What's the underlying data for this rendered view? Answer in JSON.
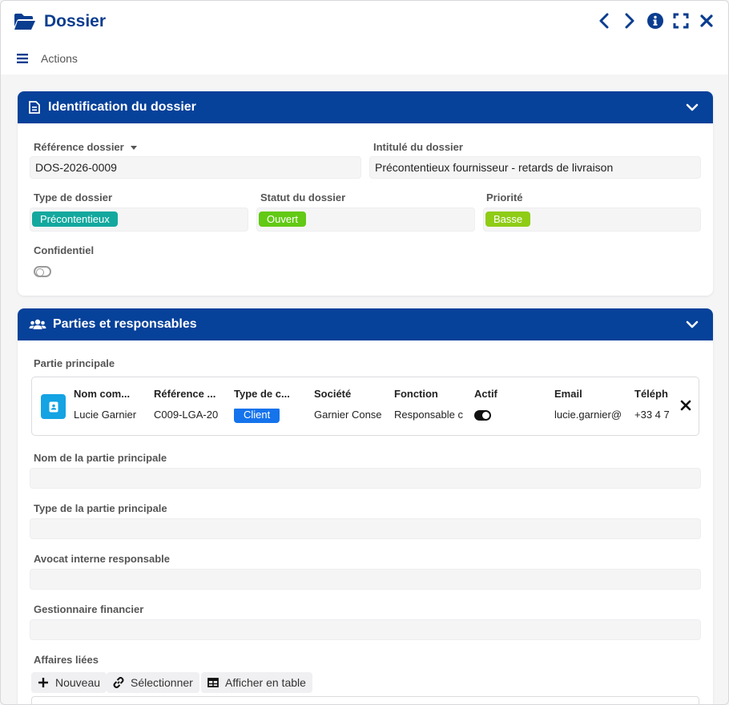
{
  "window": {
    "title": "Dossier",
    "actions_label": "Actions"
  },
  "colors": {
    "brand": "#06419a",
    "title": "#0a3d8f",
    "tag_teal": "#13a89e",
    "tag_green": "#62c914",
    "tag_lime": "#8fcc16",
    "client_blue": "#1573ec",
    "avatar": "#14a3e3"
  },
  "identification": {
    "header": "Identification du dossier",
    "reference_label": "Référence dossier",
    "reference_value": "DOS-2026-0009",
    "intitule_label": "Intitulé du dossier",
    "intitule_value": "Précontentieux fournisseur - retards de livraison",
    "type_label": "Type de dossier",
    "type_value": "Précontentieux",
    "statut_label": "Statut du dossier",
    "statut_value": "Ouvert",
    "priorite_label": "Priorité",
    "priorite_value": "Basse",
    "confidentiel_label": "Confidentiel"
  },
  "parties": {
    "header": "Parties et responsables",
    "partie_principale_label": "Partie principale",
    "columns": [
      "Nom com...",
      "Référence ...",
      "Type de c...",
      "Société",
      "Fonction",
      "Actif",
      "Email",
      "Téléph"
    ],
    "row": {
      "nom": "Lucie Garnier",
      "reference": "C009-LGA-20",
      "type": "Client",
      "societe": "Garnier Conse",
      "fonction": "Responsable c",
      "email": "lucie.garnier@",
      "telephone": "+33 4 7"
    },
    "nom_partie_label": "Nom de la partie principale",
    "type_partie_label": "Type de la partie principale",
    "avocat_label": "Avocat interne responsable",
    "gestionnaire_label": "Gestionnaire financier",
    "affaires_label": "Affaires liées",
    "btn_nouveau": "Nouveau",
    "btn_selectionner": "Sélectionner",
    "btn_afficher": "Afficher en table"
  }
}
